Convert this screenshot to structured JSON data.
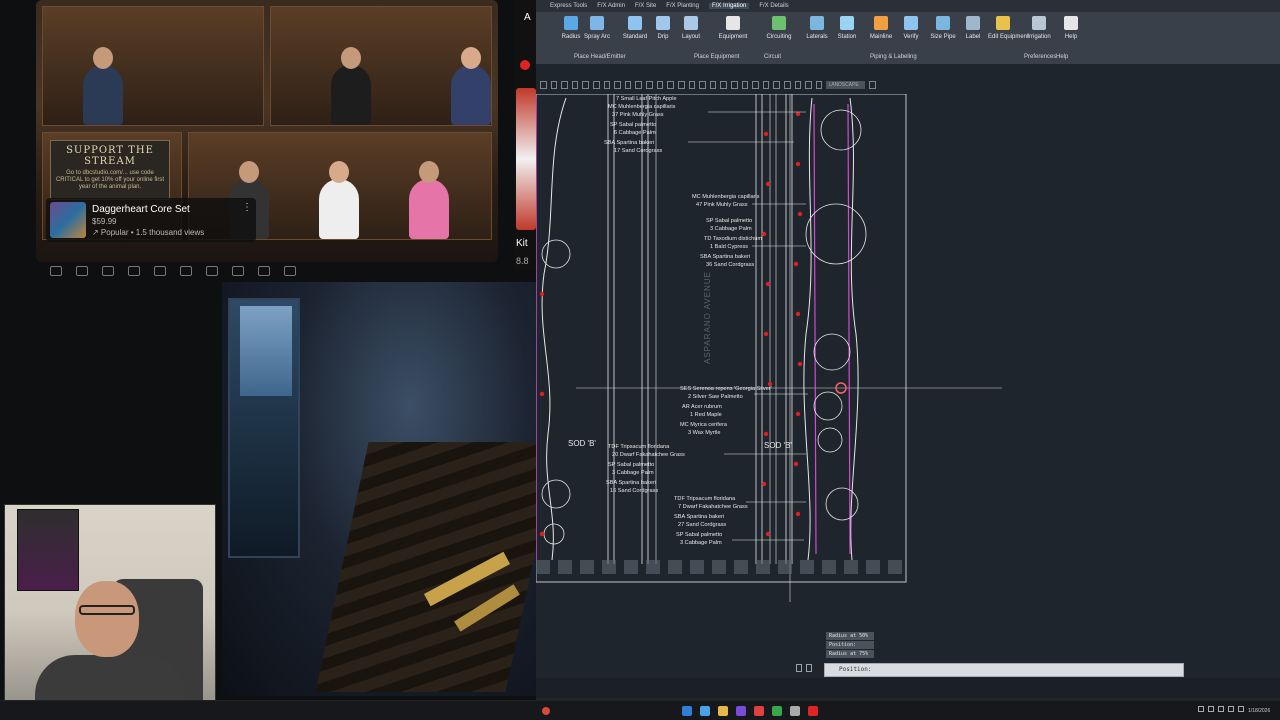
{
  "stream": {
    "support_sign": {
      "title": "SUPPORT THE STREAM",
      "body": "Go to dbcstudio.com/... use code CRITICAL to get 10% off your online first year of the animal plan."
    },
    "product_card": {
      "name": "Daggerheart Core Set",
      "price": "$59.99",
      "meta": "↗ Popular • 1.5 thousand views",
      "more_icon": "⋮"
    },
    "side_snippet": {
      "text_top": "A",
      "text_title": "Kit",
      "text_sub": "8.8"
    }
  },
  "cad": {
    "tabs": [
      "Express Tools",
      "F/X Admin",
      "F/X Site",
      "F/X Planting",
      "F/X Irrigation",
      "F/X Details"
    ],
    "active_tab": "F/X Irrigation",
    "ribbon_buttons": [
      {
        "label": "Radius",
        "icon": "radius-icon",
        "color": "#5aa8e6"
      },
      {
        "label": "Spray Arc",
        "icon": "spray-arc-icon",
        "color": "#7fb6e8"
      },
      {
        "label": "Standard",
        "icon": "standard-icon",
        "color": "#8fc3f0"
      },
      {
        "label": "Drip",
        "icon": "drip-icon",
        "color": "#9fc8ec"
      },
      {
        "label": "Layout",
        "icon": "layout-icon",
        "color": "#a9c9e6"
      },
      {
        "label": "Equipment",
        "icon": "equipment-icon",
        "color": "#e6e6e6"
      },
      {
        "label": "Circuiting",
        "icon": "circuiting-icon",
        "color": "#6cc070"
      },
      {
        "label": "Laterals",
        "icon": "laterals-icon",
        "color": "#7ab6e0"
      },
      {
        "label": "Station",
        "icon": "station-icon",
        "color": "#9bd3f2"
      },
      {
        "label": "Mainline",
        "icon": "mainline-icon",
        "color": "#f0a040"
      },
      {
        "label": "Verify",
        "icon": "verify-icon",
        "color": "#8fc3f0"
      },
      {
        "label": "Size Pipe",
        "icon": "size-pipe-icon",
        "color": "#7ab6e0"
      },
      {
        "label": "Label",
        "icon": "label-icon",
        "color": "#9fb7cc"
      },
      {
        "label": "Edit Equipment",
        "icon": "edit-equipment-icon",
        "color": "#e8c24a"
      },
      {
        "label": "Irrigation",
        "icon": "irrigation-icon",
        "color": "#b8c6d6"
      },
      {
        "label": "Help",
        "icon": "help-icon",
        "color": "#e6e6e6"
      }
    ],
    "ribbon_groups": [
      "Place Head/Emitter",
      "Place Equipment",
      "Circuit",
      "Piping & Labeling",
      "Preferences",
      "Help"
    ],
    "qat_field": "LANDSCAPE",
    "plant_labels": {
      "group1": [
        "7 Small Leaf Pitch Apple",
        "MC Muhlenbergia capillaris",
        "37 Pink Muhly Grass",
        "SP Sabal palmetto",
        "6 Cabbage Palm",
        "SBA Spartina bakeri",
        "17 Sand Cordgrass"
      ],
      "group2": [
        "MC Muhlenbergia capillaris",
        "47 Pink Muhly Grass",
        "SP Sabal palmetto",
        "3 Cabbage Palm",
        "TD Taxodium distichum",
        "1 Bald Cypress",
        "SBA Spartina bakeri",
        "36 Sand Cordgrass"
      ],
      "group3": [
        "SES Serenoa repens 'Georgia Silver'",
        "2 Silver Saw Palmetto",
        "AR Acer rubrum",
        "1 Red Maple",
        "MC Myrica cerifera",
        "3 Wax Myrtle"
      ],
      "group4": [
        "TDF Tripsacum floridana",
        "20 Dwarf Fakahatchee Grass",
        "SP Sabal palmetto",
        "3 Cabbage Palm",
        "SBA Spartina bakeri",
        "16 Sand Cordgrass"
      ],
      "group5": [
        "TDF Tripsacum floridana",
        "7 Dwarf Fakahatchee Grass",
        "SBA Spartina bakeri",
        "27 Sand Cordgrass",
        "SP Sabal palmetto",
        "3 Cabbage Palm"
      ],
      "sod_left": "SOD 'B'",
      "sod_right": "SOD 'B'",
      "street": "ASPARANO AVENUE"
    },
    "command_hints": [
      "Radius at 50%",
      "Position:",
      "Radius at 75%"
    ],
    "command_line": "Position:"
  },
  "taskbar": {
    "date": "1/18/2026"
  },
  "colors": {
    "cad_background": "#1f252c",
    "drawing_lines": "#e8e8e8",
    "planting_magenta": "#d24ad2",
    "irrigation_red": "#e02020"
  }
}
